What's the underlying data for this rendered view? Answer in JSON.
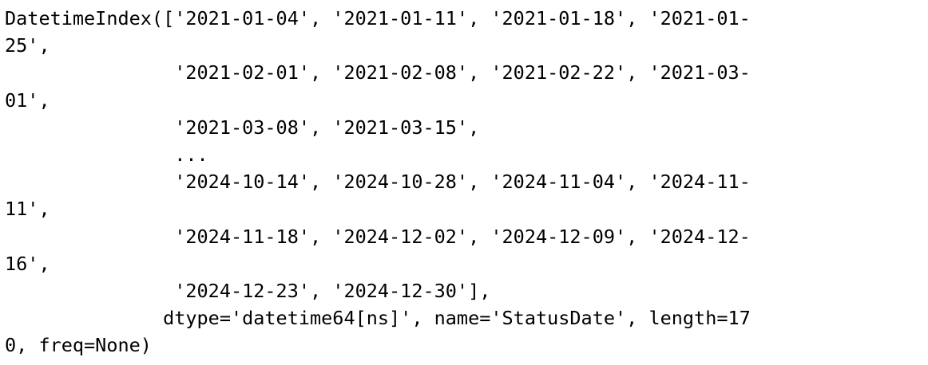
{
  "output": {
    "lines": [
      "DatetimeIndex(['2021-01-04', '2021-01-11', '2021-01-18', '2021-01-",
      "25',",
      "               '2021-02-01', '2021-02-08', '2021-02-22', '2021-03-",
      "01',",
      "               '2021-03-08', '2021-03-15',",
      "               ...",
      "               '2024-10-14', '2024-10-28', '2024-11-04', '2024-11-",
      "11',",
      "               '2024-11-18', '2024-12-02', '2024-12-09', '2024-12-",
      "16',",
      "               '2024-12-23', '2024-12-30'],",
      "              dtype='datetime64[ns]', name='StatusDate', length=17",
      "0, freq=None)"
    ]
  }
}
